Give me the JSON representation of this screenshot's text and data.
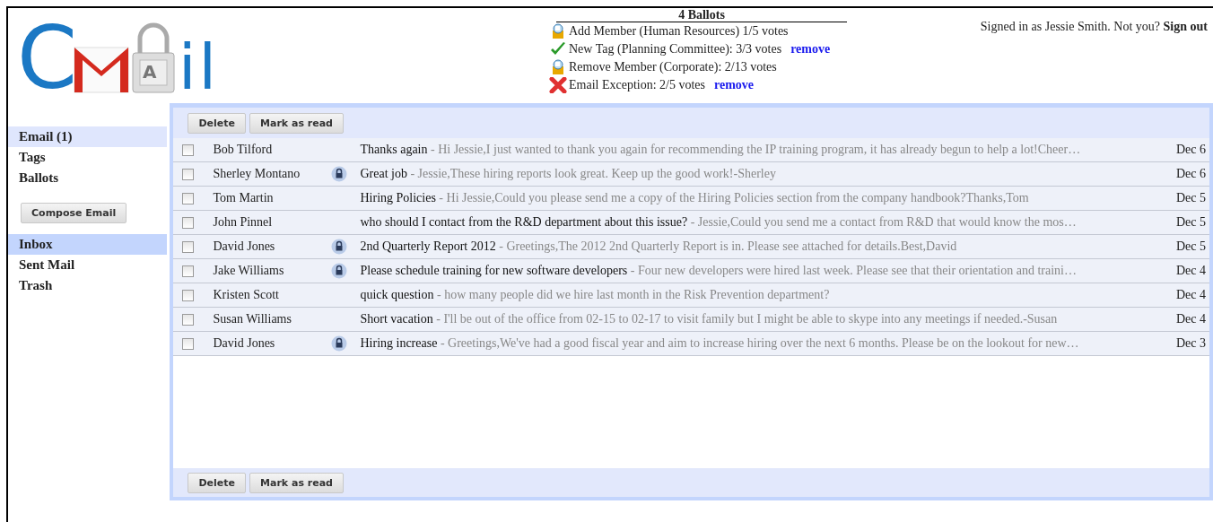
{
  "logo": {
    "first": "C",
    "lock_letter": "A",
    "last": "il"
  },
  "ballots": {
    "title": "4 Ballots",
    "items": [
      {
        "kind": "pending",
        "text": "Add Member (Human Resources) 1/5 votes"
      },
      {
        "kind": "approved",
        "text": "New Tag (Planning Committee): 3/3 votes",
        "action": "remove"
      },
      {
        "kind": "pending",
        "text": "Remove Member (Corporate): 2/13 votes"
      },
      {
        "kind": "rejected",
        "text": "Email Exception: 2/5 votes",
        "action": "remove"
      }
    ]
  },
  "account": {
    "text": "Signed in as Jessie Smith. Not you?",
    "link": "Sign out"
  },
  "sidebar": {
    "sections": [
      {
        "label": "Email (1)",
        "selected": true
      },
      {
        "label": "Tags",
        "selected": false
      },
      {
        "label": "Ballots",
        "selected": false
      }
    ],
    "compose_button": "Compose Email",
    "folders": [
      {
        "label": "Inbox",
        "selected": true
      },
      {
        "label": "Sent Mail",
        "selected": false
      },
      {
        "label": "Trash",
        "selected": false
      }
    ]
  },
  "toolbar_top": [
    "Delete",
    "Mark as read"
  ],
  "messages": [
    {
      "checked": false,
      "sender": "Bob Tilford",
      "locked": false,
      "subject": "Thanks again",
      "snippet": "- Hi Jessie,I just wanted to thank you again for recommending the IP training program, it has already begun to help a lot!Cheer…",
      "date": "Dec 6"
    },
    {
      "checked": false,
      "sender": "Sherley Montano",
      "locked": true,
      "subject": "Great job",
      "snippet": "- Jessie,These hiring reports look great. Keep up the good work!-Sherley",
      "date": "Dec 6"
    },
    {
      "checked": false,
      "sender": "Tom Martin",
      "locked": false,
      "subject": "Hiring Policies",
      "snippet": "- Hi Jessie,Could you please send me a copy of the Hiring Policies section from the company handbook?Thanks,Tom",
      "date": "Dec 5"
    },
    {
      "checked": false,
      "sender": "John Pinnel",
      "locked": false,
      "subject": "who should I contact from the R&D department about this issue?",
      "snippet": "- Jessie,Could you send me a contact from R&D that would know the mos…",
      "date": "Dec 5"
    },
    {
      "checked": false,
      "sender": "David Jones",
      "locked": true,
      "subject": "2nd Quarterly Report 2012",
      "snippet": "- Greetings,The 2012 2nd Quarterly Report is in. Please see attached for details.Best,David",
      "date": "Dec 5"
    },
    {
      "checked": false,
      "sender": "Jake Williams",
      "locked": true,
      "subject": "Please schedule training for new software developers",
      "snippet": "- Four new developers were hired last week. Please see that their orientation and traini…",
      "date": "Dec 4"
    },
    {
      "checked": false,
      "sender": "Kristen Scott",
      "locked": false,
      "subject": "quick question",
      "snippet": "- how many people did we hire last month in the Risk Prevention department?",
      "date": "Dec 4"
    },
    {
      "checked": false,
      "sender": "Susan Williams",
      "locked": false,
      "subject": "Short vacation",
      "snippet": "- I'll be out of the office from 02-15 to 02-17 to visit family but I might be able to skype into any meetings if needed.-Susan",
      "date": "Dec 4"
    },
    {
      "checked": false,
      "sender": "David Jones",
      "locked": true,
      "subject": "Hiring increase",
      "snippet": "- Greetings,We've had a good fiscal year and aim to increase hiring over the next 6 months. Please be on the lookout for new…",
      "date": "Dec 3"
    }
  ],
  "toolbar_bottom": [
    "Delete",
    "Mark as read"
  ]
}
